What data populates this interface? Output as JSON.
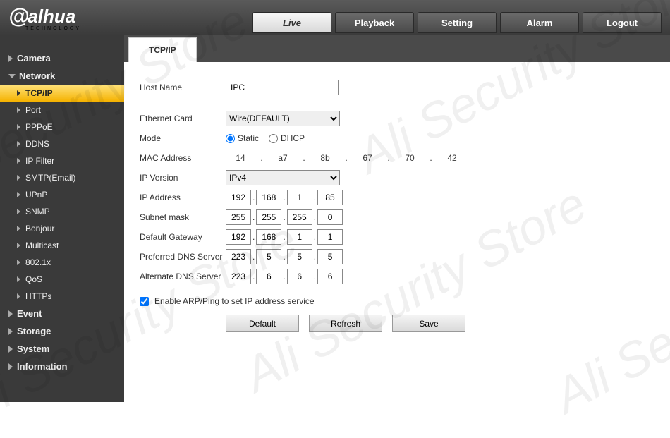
{
  "brand": {
    "name": "alhua",
    "sub": "TECHNOLOGY"
  },
  "topnav": [
    {
      "label": "Live",
      "active": true
    },
    {
      "label": "Playback"
    },
    {
      "label": "Setting"
    },
    {
      "label": "Alarm"
    },
    {
      "label": "Logout"
    }
  ],
  "sidebar": [
    {
      "label": "Camera",
      "expanded": false
    },
    {
      "label": "Network",
      "expanded": true,
      "children": [
        {
          "label": "TCP/IP",
          "active": true
        },
        {
          "label": "Port"
        },
        {
          "label": "PPPoE"
        },
        {
          "label": "DDNS"
        },
        {
          "label": "IP Filter"
        },
        {
          "label": "SMTP(Email)"
        },
        {
          "label": "UPnP"
        },
        {
          "label": "SNMP"
        },
        {
          "label": "Bonjour"
        },
        {
          "label": "Multicast"
        },
        {
          "label": "802.1x"
        },
        {
          "label": "QoS"
        },
        {
          "label": "HTTPs"
        }
      ]
    },
    {
      "label": "Event"
    },
    {
      "label": "Storage"
    },
    {
      "label": "System"
    },
    {
      "label": "Information"
    }
  ],
  "tab": {
    "title": "TCP/IP"
  },
  "form": {
    "host_name_label": "Host Name",
    "host_name_value": "IPC",
    "ethernet_card_label": "Ethernet Card",
    "ethernet_card_value": "Wire(DEFAULT)",
    "mode_label": "Mode",
    "mode_static": "Static",
    "mode_dhcp": "DHCP",
    "mode_selected": "static",
    "mac_label": "MAC Address",
    "mac": [
      "14",
      "a7",
      "8b",
      "67",
      "70",
      "42"
    ],
    "ip_version_label": "IP Version",
    "ip_version_value": "IPv4",
    "ip_address_label": "IP Address",
    "ip": [
      "192",
      "168",
      "1",
      "85"
    ],
    "subnet_label": "Subnet mask",
    "subnet": [
      "255",
      "255",
      "255",
      "0"
    ],
    "gateway_label": "Default Gateway",
    "gateway": [
      "192",
      "168",
      "1",
      "1"
    ],
    "pref_dns_label": "Preferred DNS Server",
    "pref_dns": [
      "223",
      "5",
      "5",
      "5"
    ],
    "alt_dns_label": "Alternate DNS Server",
    "alt_dns": [
      "223",
      "6",
      "6",
      "6"
    ],
    "arp_label": "Enable ARP/Ping to set IP address service",
    "arp_checked": true
  },
  "buttons": {
    "default": "Default",
    "refresh": "Refresh",
    "save": "Save"
  },
  "watermark": "Ali Security Store"
}
